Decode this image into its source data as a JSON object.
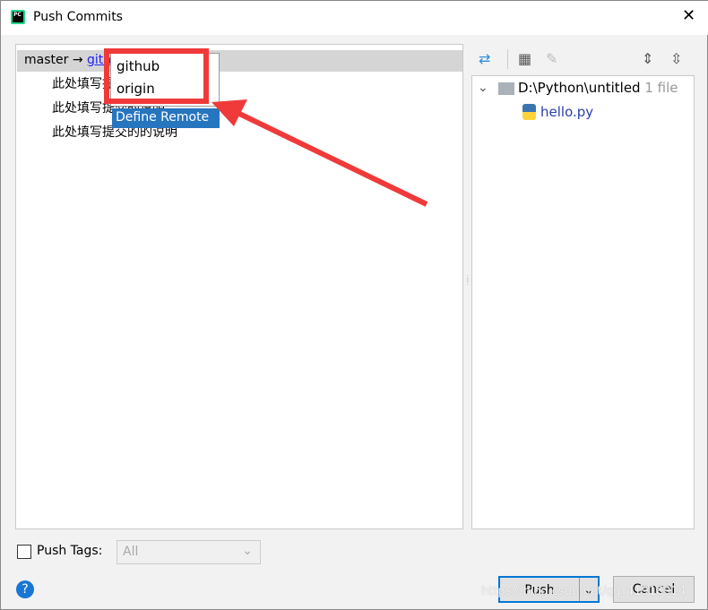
{
  "window": {
    "title": "Push Commits",
    "app_icon": "PC"
  },
  "commits": {
    "branch": "master",
    "arrow": "→",
    "target": "github",
    "messages": [
      "此处填写提交的说明",
      "此处填写提交的说明",
      "此处填写提交的的说明"
    ]
  },
  "remote_popup": {
    "options": [
      "github",
      "origin"
    ],
    "define": "Define Remote"
  },
  "files": {
    "root": "D:\\Python\\untitled",
    "count": "1 file",
    "items": [
      "hello.py"
    ]
  },
  "footer": {
    "push_tags_label": "Push Tags:",
    "tags_value": "All",
    "push": "Push",
    "cancel": "Cancel",
    "help": "?"
  },
  "watermark": "https://blog.csdn.net/qq_41918914",
  "colors": {
    "accent": "#2675bf",
    "annotation": "#f03a3a"
  }
}
